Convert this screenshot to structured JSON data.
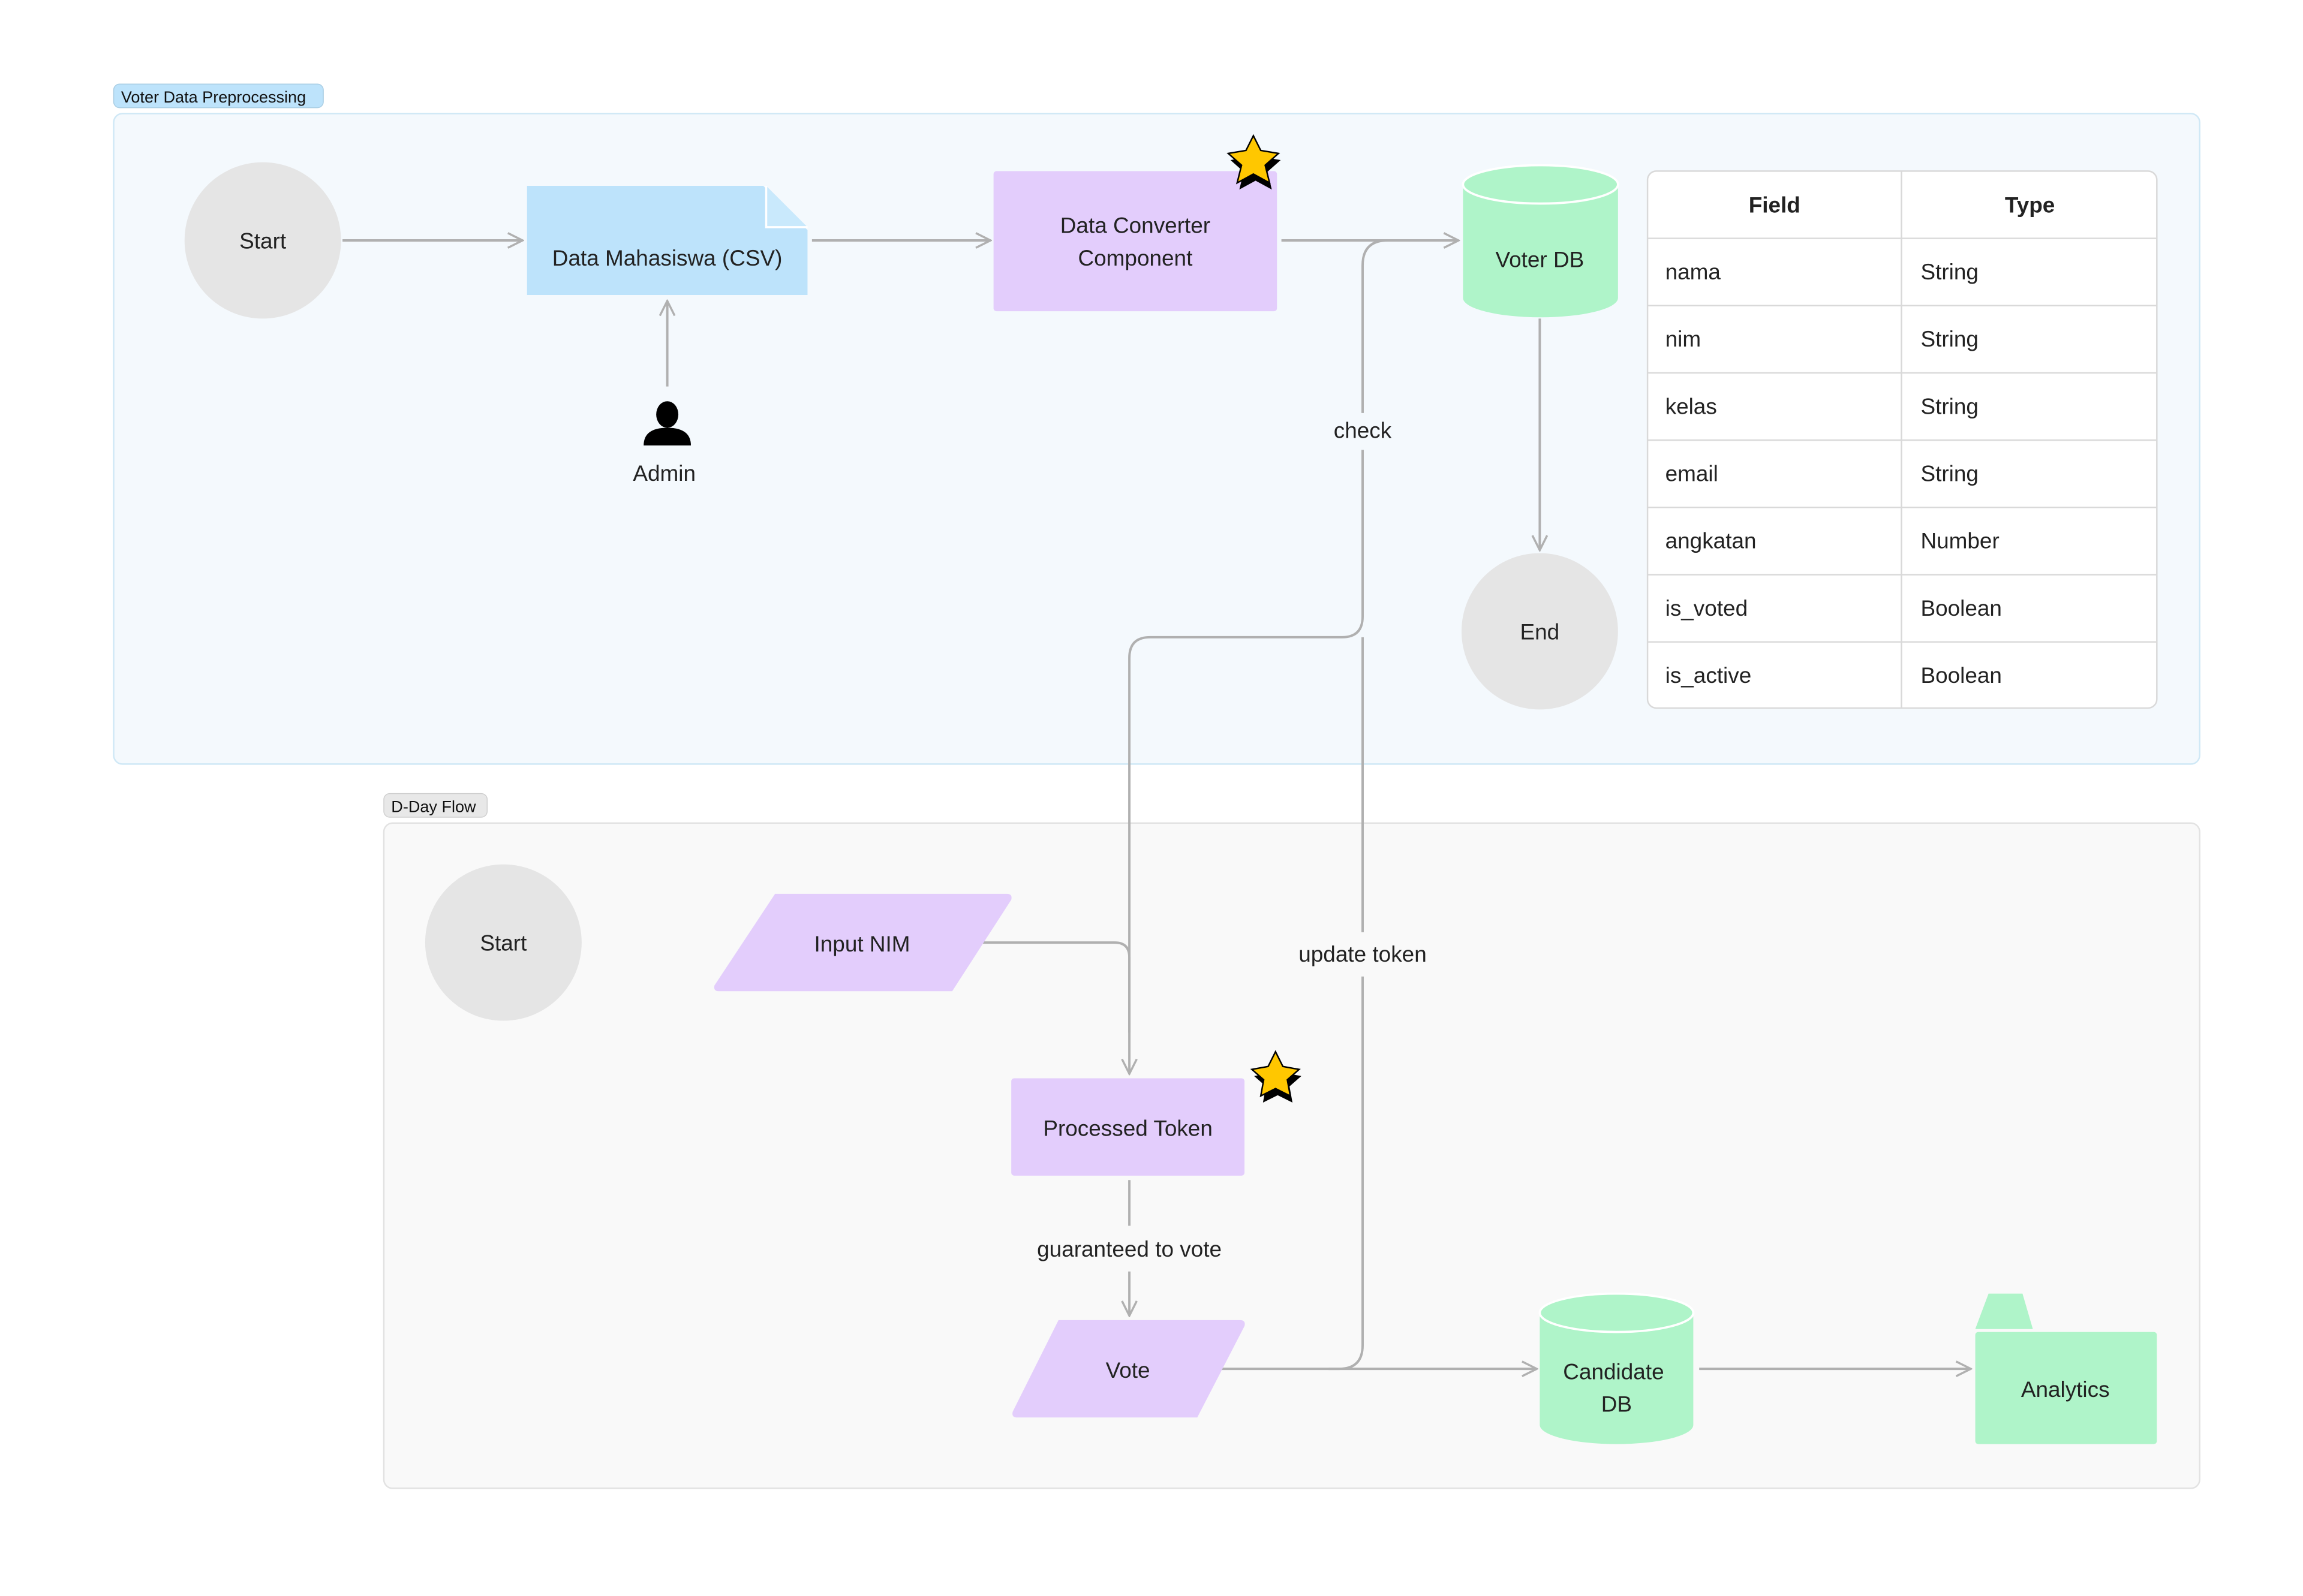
{
  "groups": [
    {
      "label": "Voter Data Preprocessing",
      "fill": "#f4f9fd",
      "stroke": "#cfe8f6",
      "label_fill": "#bde3fb"
    },
    {
      "label": "D-Day Flow",
      "fill": "#f9f9f9",
      "stroke": "#e2e2e2",
      "label_fill": "#e8e8e8"
    }
  ],
  "nodes": {
    "start1": {
      "label": "Start",
      "shape": "circle",
      "fill": "#e5e5e5"
    },
    "doc": {
      "label": "Data Mahasiswa (CSV)",
      "shape": "document",
      "fill": "#bde3fb"
    },
    "converter": {
      "label_lines": [
        "Data Converter",
        "Component"
      ],
      "shape": "rectangle",
      "fill": "#e3cdfc",
      "starred": true
    },
    "voterdb": {
      "label": "Voter DB",
      "shape": "cylinder",
      "fill": "#aff4c9"
    },
    "end": {
      "label": "End",
      "shape": "circle",
      "fill": "#e5e5e5"
    },
    "admin": {
      "label": "Admin",
      "shape": "actor",
      "icon": "person-icon"
    },
    "start2": {
      "label": "Start",
      "shape": "circle",
      "fill": "#e5e5e5"
    },
    "input_nim": {
      "label": "Input NIM",
      "shape": "parallelogram",
      "fill": "#e3cdfc"
    },
    "processed_token": {
      "label": "Processed Token",
      "shape": "rectangle",
      "fill": "#e3cdfc",
      "starred": true
    },
    "vote": {
      "label": "Vote",
      "shape": "parallelogram",
      "fill": "#e3cdfc"
    },
    "candidatedb": {
      "label_lines": [
        "Candidate",
        "DB"
      ],
      "shape": "cylinder",
      "fill": "#aff4c9"
    },
    "analytics": {
      "label": "Analytics",
      "shape": "folder",
      "fill": "#aff4c9"
    }
  },
  "edges": [
    {
      "from": "Start",
      "to": "Data Mahasiswa (CSV)",
      "label": ""
    },
    {
      "from": "Admin",
      "to": "Data Mahasiswa (CSV)",
      "label": ""
    },
    {
      "from": "Data Mahasiswa (CSV)",
      "to": "Data Converter Component",
      "label": ""
    },
    {
      "from": "Data Converter Component",
      "to": "Voter DB",
      "label": ""
    },
    {
      "from": "Voter DB",
      "to": "End",
      "label": ""
    },
    {
      "from": "Voter DB",
      "to": "Processed Token",
      "label": "check"
    },
    {
      "from": "Start",
      "to": "Input NIM",
      "label": ""
    },
    {
      "from": "Input NIM",
      "to": "Processed Token",
      "label": ""
    },
    {
      "from": "Processed Token",
      "to": "Vote",
      "label": "guaranteed to vote"
    },
    {
      "from": "Vote",
      "to": "Voter DB",
      "label": "update token"
    },
    {
      "from": "Vote",
      "to": "Candidate DB",
      "label": ""
    },
    {
      "from": "Candidate DB",
      "to": "Analytics",
      "label": ""
    }
  ],
  "edge_labels": {
    "check": "check",
    "update_token": "update token",
    "guaranteed": "guaranteed to vote"
  },
  "table": {
    "headers": [
      "Field",
      "Type"
    ],
    "rows": [
      [
        "nama",
        "String"
      ],
      [
        "nim",
        "String"
      ],
      [
        "kelas",
        "String"
      ],
      [
        "email",
        "String"
      ],
      [
        "angkatan",
        "Number"
      ],
      [
        "is_voted",
        "Boolean"
      ],
      [
        "is_active",
        "Boolean"
      ]
    ]
  },
  "colors": {
    "edge": "#b0b0b0",
    "star": "#ffc700",
    "text": "#222222"
  }
}
